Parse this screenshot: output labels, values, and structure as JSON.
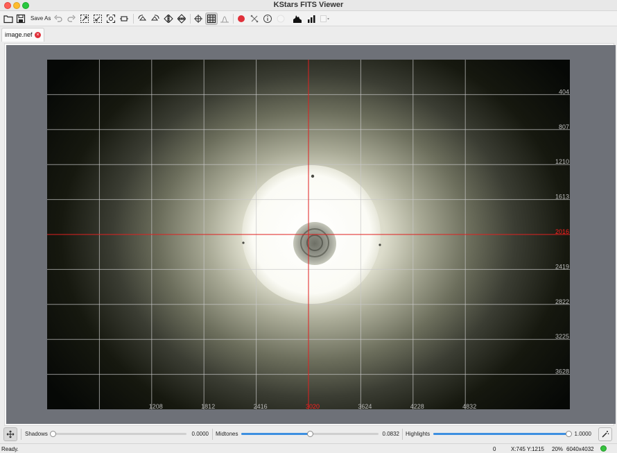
{
  "window": {
    "title": "KStars FITS Viewer"
  },
  "toolbar": {
    "save_as_label": "Save As",
    "colors": {
      "record": "#e0303a"
    }
  },
  "tab": {
    "label": "image.nef"
  },
  "image": {
    "colors": {
      "grid": "#c8c8c8",
      "crosshair": "#e02020",
      "crosshair_label": "#ff2020"
    },
    "x_labels": [
      {
        "text": "1208",
        "highlight": false
      },
      {
        "text": "1812",
        "highlight": false
      },
      {
        "text": "2416",
        "highlight": false
      },
      {
        "text": "3020",
        "highlight": true
      },
      {
        "text": "3624",
        "highlight": false
      },
      {
        "text": "4228",
        "highlight": false
      },
      {
        "text": "4832",
        "highlight": false
      }
    ],
    "y_labels": [
      {
        "text": "404",
        "highlight": false
      },
      {
        "text": "807",
        "highlight": false
      },
      {
        "text": "1210",
        "highlight": false
      },
      {
        "text": "1613",
        "highlight": false
      },
      {
        "text": "2016",
        "highlight": true
      },
      {
        "text": "2419",
        "highlight": false
      },
      {
        "text": "2822",
        "highlight": false
      },
      {
        "text": "3225",
        "highlight": false
      },
      {
        "text": "3628",
        "highlight": false
      }
    ]
  },
  "stretch": {
    "shadows": {
      "label": "Shadows",
      "value": "0.0000",
      "fraction": 0.0
    },
    "midtones": {
      "label": "Midtones",
      "value": "0.0832",
      "fraction": 0.5
    },
    "highlights": {
      "label": "Highlights",
      "value": "1.0000",
      "fraction": 1.0
    },
    "accent": "#3d8fe0"
  },
  "status": {
    "message": "Ready.",
    "value": "0",
    "cursor": "X:745 Y:1215",
    "zoom": "20%",
    "resolution": "6040x4032",
    "led_color": "#36c23e"
  }
}
